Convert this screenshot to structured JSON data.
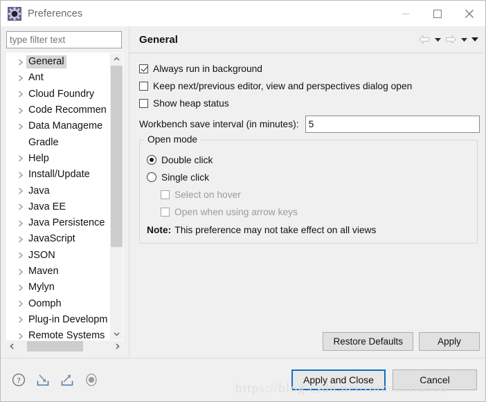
{
  "window": {
    "title": "Preferences",
    "icon": "gear-icon",
    "minimize_label": "—",
    "maximize_label": "□",
    "close_label": "✕"
  },
  "sidebar": {
    "filter": {
      "value": "",
      "placeholder": "type filter text"
    },
    "items": [
      {
        "label": "General",
        "expandable": true,
        "selected": true
      },
      {
        "label": "Ant",
        "expandable": true,
        "selected": false
      },
      {
        "label": "Cloud Foundry",
        "expandable": true,
        "selected": false
      },
      {
        "label": "Code Recommen",
        "expandable": true,
        "selected": false
      },
      {
        "label": "Data Manageme",
        "expandable": true,
        "selected": false
      },
      {
        "label": "Gradle",
        "expandable": false,
        "selected": false
      },
      {
        "label": "Help",
        "expandable": true,
        "selected": false
      },
      {
        "label": "Install/Update",
        "expandable": true,
        "selected": false
      },
      {
        "label": "Java",
        "expandable": true,
        "selected": false
      },
      {
        "label": "Java EE",
        "expandable": true,
        "selected": false
      },
      {
        "label": "Java Persistence",
        "expandable": true,
        "selected": false
      },
      {
        "label": "JavaScript",
        "expandable": true,
        "selected": false
      },
      {
        "label": "JSON",
        "expandable": true,
        "selected": false
      },
      {
        "label": "Maven",
        "expandable": true,
        "selected": false
      },
      {
        "label": "Mylyn",
        "expandable": true,
        "selected": false
      },
      {
        "label": "Oomph",
        "expandable": true,
        "selected": false
      },
      {
        "label": "Plug-in Developm",
        "expandable": true,
        "selected": false
      },
      {
        "label": "Remote Systems",
        "expandable": true,
        "selected": false
      }
    ]
  },
  "page": {
    "title": "General",
    "nav": {
      "back_icon": "back-arrow-icon",
      "back_menu_icon": "chevron-down-icon",
      "forward_icon": "forward-arrow-icon",
      "forward_menu_icon": "chevron-down-icon",
      "view_menu_icon": "chevron-down-icon"
    },
    "checkboxes": [
      {
        "label": "Always run in background",
        "checked": true,
        "enabled": true
      },
      {
        "label": "Keep next/previous editor, view and perspectives dialog open",
        "checked": false,
        "enabled": true
      },
      {
        "label": "Show heap status",
        "checked": false,
        "enabled": true
      }
    ],
    "interval": {
      "label": "Workbench save interval (in minutes):",
      "value": "5"
    },
    "open_mode": {
      "legend": "Open mode",
      "radios": [
        {
          "label": "Double click",
          "checked": true
        },
        {
          "label": "Single click",
          "checked": false
        }
      ],
      "sub_checkboxes": [
        {
          "label": "Select on hover",
          "checked": false,
          "enabled": false
        },
        {
          "label": "Open when using arrow keys",
          "checked": false,
          "enabled": false
        }
      ],
      "note_prefix": "Note:",
      "note_text": "This preference may not take effect on all views"
    },
    "actions": {
      "restore_defaults": "Restore Defaults",
      "apply": "Apply"
    }
  },
  "footer": {
    "icons": [
      {
        "name": "help-icon"
      },
      {
        "name": "import-icon"
      },
      {
        "name": "export-icon"
      },
      {
        "name": "record-icon"
      }
    ],
    "apply_and_close": "Apply and Close",
    "cancel": "Cancel"
  },
  "watermark": "https://blog.csdn.net/rothschild666",
  "colors": {
    "focus_border": "#0c6fc4",
    "window_bg": "#f0f0f0",
    "tree_bg": "#ffffff",
    "selection": "#d6d6d6",
    "scrollbar_thumb": "#cdcdcd"
  }
}
